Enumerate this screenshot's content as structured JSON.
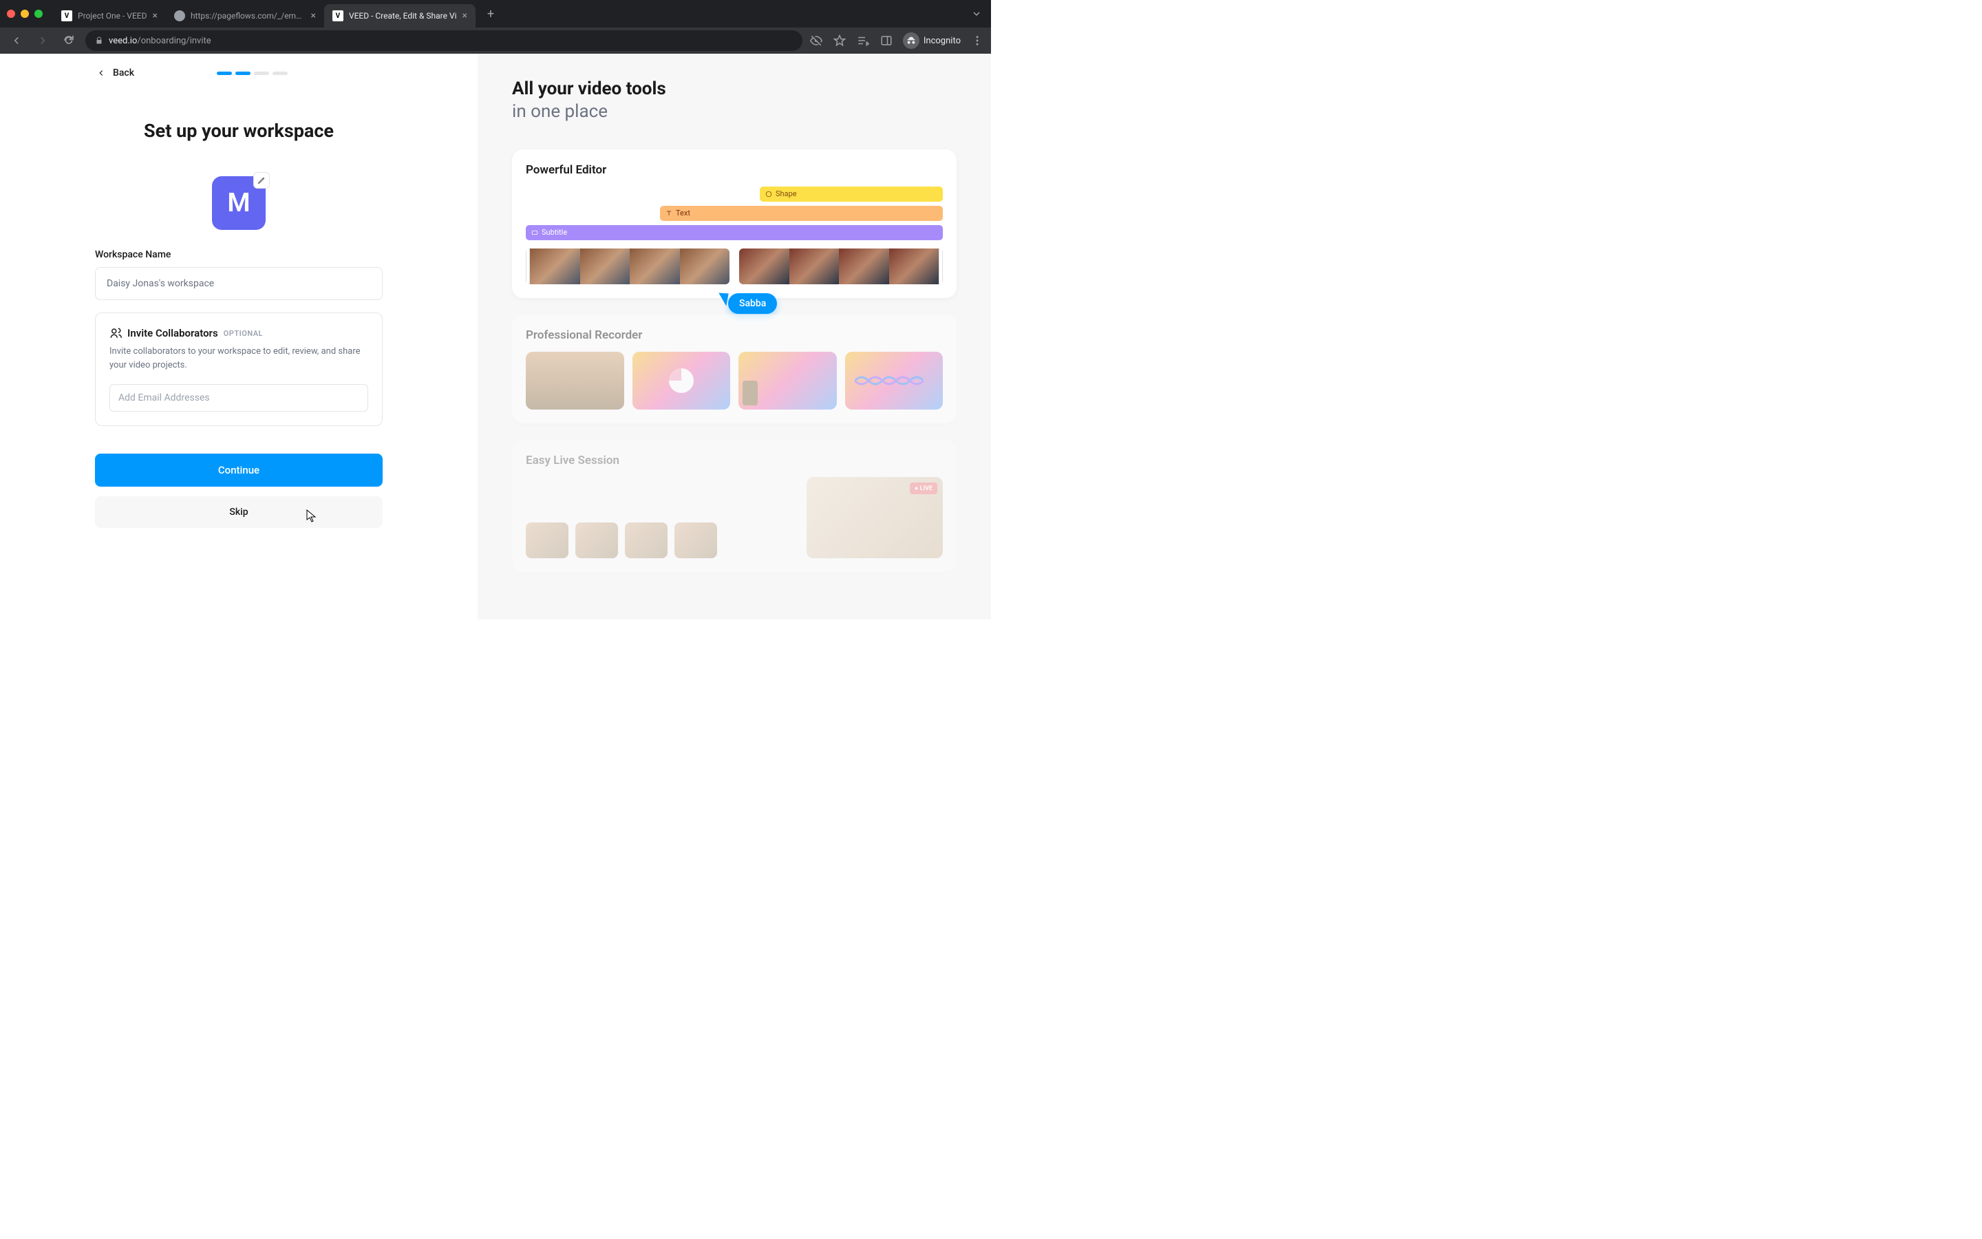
{
  "browser": {
    "tabs": [
      {
        "title": "Project One - VEED",
        "favicon": "V",
        "active": false
      },
      {
        "title": "https://pageflows.com/_/emails",
        "favicon": "globe",
        "active": false
      },
      {
        "title": "VEED - Create, Edit & Share Vi",
        "favicon": "V",
        "active": true
      }
    ],
    "url_domain": "veed.io",
    "url_path": "/onboarding/invite",
    "incognito_label": "Incognito"
  },
  "onboarding": {
    "back_label": "Back",
    "progress_total": 4,
    "progress_current": 2,
    "title": "Set up your workspace",
    "avatar_initial": "M",
    "workspace_name_label": "Workspace Name",
    "workspace_name_value": "Daisy Jonas's workspace",
    "invite": {
      "title": "Invite Collaborators",
      "optional_badge": "OPTIONAL",
      "description": "Invite collaborators to your workspace to edit, review, and share your video projects.",
      "email_placeholder": "Add Email Addresses"
    },
    "continue_label": "Continue",
    "skip_label": "Skip"
  },
  "promo": {
    "heading_line1": "All your video tools",
    "heading_line2": "in one place",
    "editor": {
      "title": "Powerful Editor",
      "track_shape": "Shape",
      "track_text": "Text",
      "track_subtitle": "Subtitle",
      "cursor_user": "Sabba"
    },
    "recorder": {
      "title": "Professional Recorder"
    },
    "live": {
      "title": "Easy Live Session",
      "live_badge": "LIVE"
    }
  }
}
